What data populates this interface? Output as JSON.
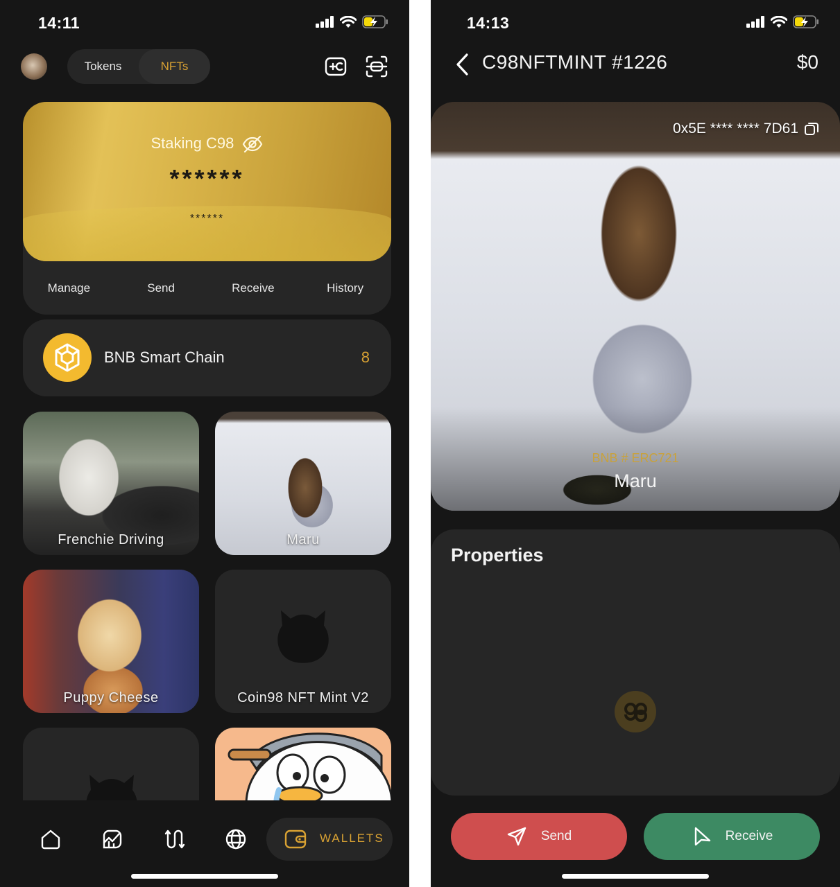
{
  "left_screen": {
    "status": {
      "time": "14:11"
    },
    "segment": {
      "tokens": "Tokens",
      "nfts": "NFTs",
      "selected": "NFTs"
    },
    "card": {
      "title": "Staking C98",
      "balance": "******",
      "sub_balance": "******",
      "actions": [
        "Manage",
        "Send",
        "Receive",
        "History"
      ]
    },
    "chain": {
      "name": "BNB Smart Chain",
      "count": "8"
    },
    "nfts": [
      {
        "name": "Frenchie Driving"
      },
      {
        "name": "Maru"
      },
      {
        "name": "Puppy Cheese"
      },
      {
        "name": "Coin98 NFT Mint V2"
      }
    ],
    "tabbar": {
      "active_label": "WALLETS"
    }
  },
  "right_screen": {
    "status": {
      "time": "14:13"
    },
    "nav": {
      "title": "C98NFTMINT #1226",
      "price": "$0"
    },
    "nft": {
      "address": "0x5E **** **** 7D61",
      "chain_standard": "BNB # ERC721",
      "name": "Maru"
    },
    "properties_title": "Properties",
    "buttons": {
      "send": "Send",
      "receive": "Receive"
    }
  },
  "colors": {
    "background": "#161616",
    "surface": "#262626",
    "accent_gold": "#d9a233",
    "send_red": "#cf4e4e",
    "receive_green": "#3d8a63"
  }
}
